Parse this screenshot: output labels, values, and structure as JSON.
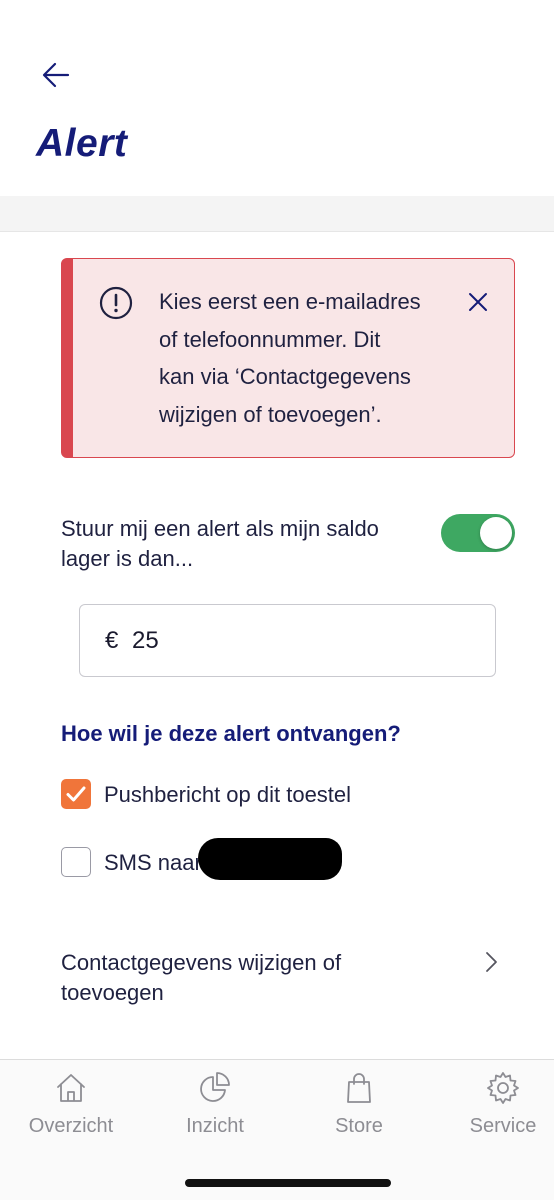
{
  "header": {
    "back_icon": "arrow-left-icon",
    "title": "Alert"
  },
  "alert": {
    "icon": "exclamation-circle-icon",
    "lines": [
      "Kies eerst een e-mailadres",
      "of telefoonnummer. Dit",
      "kan via ‘Contactgegevens",
      "wijzigen of toevoegen’."
    ],
    "close_icon": "close-icon",
    "colors": {
      "background": "#f9e6e7",
      "border": "#d9474f"
    }
  },
  "balance_alert": {
    "label_lines": [
      "Stuur mij een alert als mijn saldo",
      "lager is dan..."
    ],
    "toggle_on": true,
    "toggle_color": "#3ea862"
  },
  "amount": {
    "currency": "€",
    "value": "25"
  },
  "delivery": {
    "heading": "Hoe wil je deze alert ontvangen?",
    "options": [
      {
        "label": "Pushbericht op dit toestel",
        "checked": true
      },
      {
        "label": "SMS naar",
        "checked": false
      }
    ],
    "checked_color": "#f0753a"
  },
  "contact_link": {
    "label_lines": [
      "Contactgegevens wijzigen of",
      "toevoegen"
    ],
    "icon": "chevron-right-icon"
  },
  "tabbar": {
    "tabs": [
      {
        "label": "Overzicht",
        "icon": "home-icon"
      },
      {
        "label": "Inzicht",
        "icon": "pie-chart-icon"
      },
      {
        "label": "Store",
        "icon": "shopping-bag-icon"
      },
      {
        "label": "Service",
        "icon": "gear-icon"
      }
    ]
  },
  "colors": {
    "brand": "#151c78",
    "text": "#1f2140",
    "tab_inactive": "#8d8d93"
  }
}
